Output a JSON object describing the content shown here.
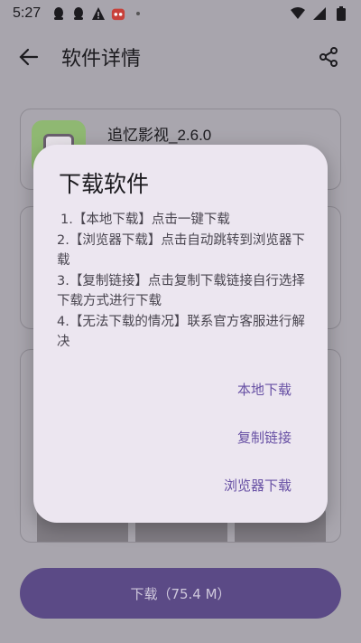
{
  "status_bar": {
    "time": "5:27"
  },
  "app_bar": {
    "title": "软件详情"
  },
  "app_info": {
    "name": "追忆影视_2.6.0"
  },
  "dialog": {
    "title": "下载软件",
    "instructions": [
      "1.【本地下载】点击一键下载",
      "2.【浏览器下载】点击自动跳转到浏览器下载",
      "3.【复制链接】点击复制下载链接自行选择下载方式进行下载",
      "4.【无法下载的情况】联系官方客服进行解决"
    ],
    "actions": {
      "local": "本地下载",
      "copy": "复制链接",
      "browser": "浏览器下载"
    }
  },
  "download_button": {
    "label": "下载（75.4 M）"
  },
  "colors": {
    "accent": "#6750a4",
    "dialog_bg": "#ece6f0",
    "button_bg": "#5b4a86",
    "scrim": "#a8a5ad"
  }
}
